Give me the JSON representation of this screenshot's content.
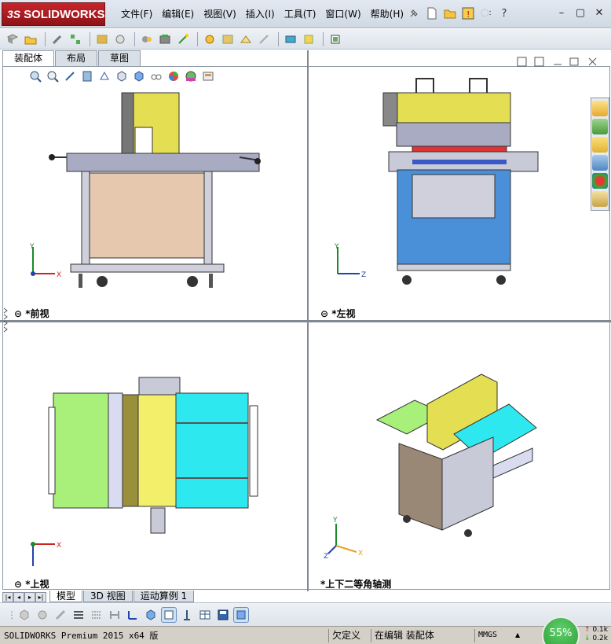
{
  "brand": {
    "logo_text": "SOLIDWORKS",
    "logo_prefix": "3S"
  },
  "menu": [
    "文件(F)",
    "编辑(E)",
    "视图(V)",
    "插入(I)",
    "工具(T)",
    "窗口(W)",
    "帮助(H)"
  ],
  "titleicons": [
    "pin-icon",
    "new-document-icon",
    "open-folder-icon",
    "rebuild-warning-icon",
    "options-icon",
    "help-icon"
  ],
  "title_more": "ઃ",
  "window_controls": {
    "minimize": "–",
    "restore": "▢",
    "close": "✕"
  },
  "doc_tabs": [
    "装配体",
    "布局",
    "草图"
  ],
  "view_labels": {
    "front": "*前视",
    "left": "*左视",
    "top": "*上视",
    "iso": "*上下二等角轴测"
  },
  "axes": {
    "front": {
      "v": "Y",
      "h": "X"
    },
    "left": {
      "v": "Y",
      "h": "Z"
    },
    "top": {
      "v": "X",
      "h": "X"
    },
    "iso": {
      "v": "Y",
      "h": "X",
      "z": "Z"
    }
  },
  "bottom_tabs": [
    "模型",
    "3D 视图",
    "运动算例 1"
  ],
  "status": {
    "product": "SOLIDWORKS Premium 2015 x64 版",
    "state1": "欠定义",
    "state2": "在编辑 装配体",
    "units": "MMGS",
    "caret": "▲"
  },
  "gauge": {
    "percent": "55%"
  },
  "net": {
    "up": "0.1k",
    "down": "0.2k"
  },
  "colors": {
    "accent": "#c7252b",
    "gauge": "#2a9a35"
  }
}
